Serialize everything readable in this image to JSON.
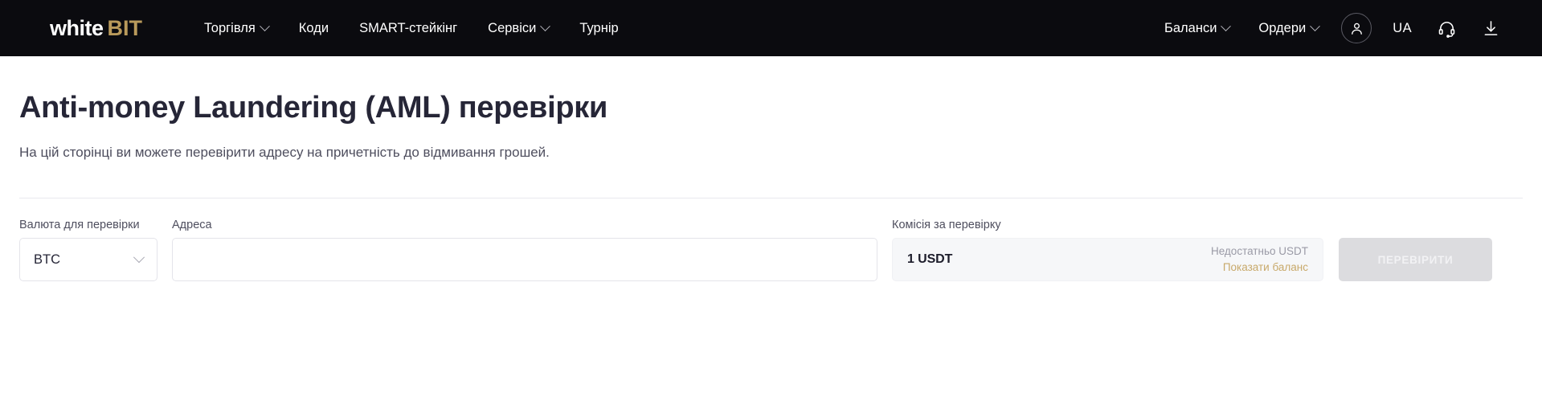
{
  "brand": {
    "logo_white": "white",
    "logo_accent": "BIT",
    "accent_color": "#b99a5b"
  },
  "nav": {
    "left_items": [
      {
        "label": "Торгівля",
        "has_dropdown": true
      },
      {
        "label": "Коди",
        "has_dropdown": false
      },
      {
        "label": "SMART-стейкінг",
        "has_dropdown": false
      },
      {
        "label": "Сервіси",
        "has_dropdown": true
      },
      {
        "label": "Турнір",
        "has_dropdown": false
      }
    ],
    "right_items": [
      {
        "label": "Баланси",
        "has_dropdown": true
      },
      {
        "label": "Ордери",
        "has_dropdown": true
      }
    ],
    "account_icon": "user-icon",
    "language": "UA",
    "support_icon": "headset-icon",
    "download_icon": "download-icon"
  },
  "page": {
    "title": "Anti-money Laundering (AML) перевірки",
    "subtitle": "На цій сторінці ви можете перевірити адресу на причетність до відмивання грошей."
  },
  "form": {
    "currency": {
      "label": "Валюта для перевірки",
      "selected": "BTC",
      "options": [
        "BTC"
      ]
    },
    "address": {
      "label": "Адреса",
      "value": "",
      "placeholder": ""
    },
    "fee": {
      "label": "Комісія за перевірку",
      "amount": "1 USDT",
      "insufficient_text": "Недостатньо USDT",
      "show_balance_link": "Показати баланс",
      "link_color": "#c8a96a"
    },
    "submit": {
      "label": "ПЕРЕВІРИТИ",
      "disabled": true
    }
  }
}
